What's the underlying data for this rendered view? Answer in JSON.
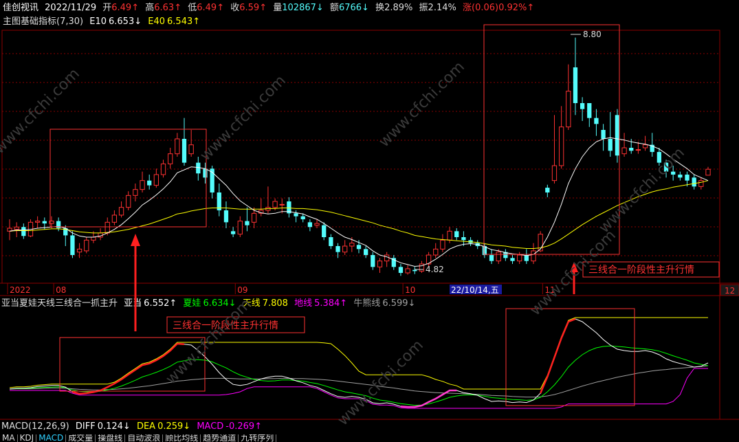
{
  "header": {
    "app": "佳创视讯",
    "date": "2022/11/29",
    "open_label": "开",
    "open": "6.49↑",
    "high_label": "高",
    "high": "6.63↑",
    "low_label": "低",
    "low": "6.49↑",
    "close_label": "收",
    "close": "6.59↑",
    "volume_label": "量",
    "volume": "102867↓",
    "amount_label": "额",
    "amount": "6766↓",
    "turnover_label": "换",
    "turnover": "2.89%",
    "amplitude_label": "振",
    "amplitude": "2.14%",
    "change_label": "涨",
    "change": "(0.06)0.92%↑"
  },
  "indicator_line": {
    "name": "主图基础指标(7,30)",
    "e10_label": "E10",
    "e10": "6.653↓",
    "e40_label": "E40",
    "e40": "6.543↑"
  },
  "mid_indicator": {
    "name": "亚当夏娃天线三线合一抓主升",
    "yadang_label": "亚当",
    "yadang": "6.552↑",
    "xiawa_label": "夏娃",
    "xiawa": "6.634↓",
    "tianxian_label": "天线",
    "tianxian": "7.808",
    "dixian_label": "地线",
    "dixian": "5.384↑",
    "niuxiong_label": "牛熊线",
    "niuxiong": "6.599↓"
  },
  "macd": {
    "name": "MACD(12,26,9)",
    "diff_label": "DIFF",
    "diff": "0.124↓",
    "dea_label": "DEA",
    "dea": "0.259↓",
    "macd_label": "MACD",
    "macd": "-0.269↑"
  },
  "annotations": {
    "box_label": "三线合一阶段性主升行情",
    "max_price": "8.80",
    "min_price": "4.82",
    "cursor_date": "22/10/14,五",
    "right_badge": "12",
    "watermark": "www.cfchi.com"
  },
  "tabs": [
    "MA",
    "KDJ",
    "MACD",
    "成交量",
    "操盘线",
    "自动波浪",
    "顾比均线",
    "趋势通道",
    "九转序列"
  ],
  "active_tab": "MACD",
  "colors": {
    "up": "#ff3232",
    "down": "#54fcfc",
    "e10": "#ffffff",
    "e40": "#ffff00",
    "yadang": "#ffffff",
    "xiawa": "#00ff00",
    "tianxian": "#ffff00",
    "dixian": "#ff00ff",
    "niuxiong": "#a0a0a0",
    "box": "#ff3232",
    "macd_line": "#ff00ff"
  },
  "chart_data": {
    "type": "candlestick",
    "x_axis_labels": [
      "2022",
      "08",
      "09",
      "10",
      "11",
      "12"
    ],
    "price_range": [
      4.7,
      8.9
    ],
    "candles": [
      [
        5.55,
        5.6,
        5.75,
        5.4
      ],
      [
        5.58,
        5.62,
        5.7,
        5.45
      ],
      [
        5.62,
        5.47,
        5.68,
        5.42
      ],
      [
        5.47,
        5.7,
        5.75,
        5.45
      ],
      [
        5.7,
        5.72,
        5.8,
        5.6
      ],
      [
        5.72,
        5.68,
        5.78,
        5.58
      ],
      [
        5.68,
        5.72,
        5.8,
        5.6
      ],
      [
        5.72,
        5.6,
        5.78,
        5.55
      ],
      [
        5.6,
        5.48,
        5.65,
        5.3
      ],
      [
        5.48,
        5.15,
        5.55,
        5.1
      ],
      [
        5.2,
        5.25,
        5.35,
        5.1
      ],
      [
        5.22,
        5.4,
        5.45,
        5.18
      ],
      [
        5.4,
        5.45,
        5.55,
        5.35
      ],
      [
        5.45,
        5.52,
        5.6,
        5.4
      ],
      [
        5.52,
        5.7,
        5.78,
        5.48
      ],
      [
        5.7,
        5.82,
        5.9,
        5.65
      ],
      [
        5.82,
        5.95,
        6.05,
        5.78
      ],
      [
        5.95,
        6.15,
        6.22,
        5.9
      ],
      [
        6.15,
        6.25,
        6.35,
        6.05
      ],
      [
        6.25,
        6.4,
        6.55,
        6.2
      ],
      [
        6.4,
        6.32,
        6.5,
        6.25
      ],
      [
        6.32,
        6.5,
        6.6,
        6.28
      ],
      [
        6.5,
        6.68,
        6.75,
        6.45
      ],
      [
        6.68,
        6.85,
        6.95,
        6.6
      ],
      [
        6.85,
        7.1,
        7.2,
        6.8
      ],
      [
        7.1,
        6.7,
        7.45,
        6.65
      ],
      [
        6.85,
        7.0,
        7.25,
        6.8
      ],
      [
        6.7,
        6.52,
        6.8,
        6.4
      ],
      [
        6.6,
        6.45,
        6.7,
        6.35
      ],
      [
        6.6,
        6.2,
        6.65,
        6.1
      ],
      [
        6.2,
        5.9,
        6.35,
        5.8
      ],
      [
        5.9,
        5.7,
        6.05,
        5.6
      ],
      [
        5.55,
        5.5,
        5.62,
        5.45
      ],
      [
        5.5,
        5.72,
        5.8,
        5.45
      ],
      [
        5.72,
        5.65,
        5.95,
        5.55
      ],
      [
        5.7,
        5.85,
        5.95,
        5.6
      ],
      [
        5.85,
        5.9,
        6.1,
        5.8
      ],
      [
        5.9,
        5.95,
        6.3,
        5.85
      ],
      [
        5.95,
        6.05,
        6.1,
        5.9
      ],
      [
        6.0,
        6.0,
        6.1,
        5.85
      ],
      [
        6.05,
        5.85,
        6.12,
        5.78
      ],
      [
        5.85,
        5.8,
        5.9,
        5.7
      ],
      [
        5.8,
        5.75,
        5.85,
        5.7
      ],
      [
        5.7,
        5.62,
        5.75,
        5.55
      ],
      [
        5.65,
        5.68,
        5.75,
        5.6
      ],
      [
        5.65,
        5.45,
        5.7,
        5.4
      ],
      [
        5.45,
        5.3,
        5.5,
        5.25
      ],
      [
        5.3,
        5.2,
        5.35,
        5.1
      ],
      [
        5.2,
        5.3,
        5.4,
        5.15
      ],
      [
        5.3,
        5.35,
        5.45,
        5.2
      ],
      [
        5.32,
        5.25,
        5.4,
        5.18
      ],
      [
        5.25,
        5.15,
        5.3,
        5.1
      ],
      [
        5.15,
        4.95,
        5.2,
        4.9
      ],
      [
        4.95,
        5.05,
        5.1,
        4.85
      ],
      [
        5.05,
        5.15,
        5.2,
        4.95
      ],
      [
        5.1,
        4.95,
        5.15,
        4.9
      ],
      [
        4.95,
        4.85,
        5.0,
        4.8
      ],
      [
        4.85,
        4.92,
        4.98,
        4.82
      ],
      [
        4.9,
        4.88,
        4.95,
        4.83
      ],
      [
        4.88,
        5.0,
        5.05,
        4.85
      ],
      [
        5.0,
        5.15,
        5.2,
        4.95
      ],
      [
        5.15,
        5.25,
        5.35,
        5.1
      ],
      [
        5.25,
        5.4,
        5.5,
        5.2
      ],
      [
        5.4,
        5.55,
        5.62,
        5.35
      ],
      [
        5.55,
        5.45,
        5.6,
        5.4
      ],
      [
        5.45,
        5.4,
        5.55,
        5.3
      ],
      [
        5.4,
        5.35,
        5.45,
        5.3
      ],
      [
        5.35,
        5.3,
        5.4,
        5.25
      ],
      [
        5.3,
        5.15,
        5.35,
        5.1
      ],
      [
        5.15,
        5.05,
        5.25,
        5.0
      ],
      [
        5.05,
        5.2,
        5.25,
        5.0
      ],
      [
        5.2,
        5.1,
        5.25,
        5.05
      ],
      [
        5.1,
        5.05,
        5.15,
        5.0
      ],
      [
        5.05,
        5.15,
        5.2,
        5.0
      ],
      [
        5.15,
        5.05,
        5.25,
        5.0
      ],
      [
        5.05,
        5.22,
        5.35,
        5.0
      ],
      [
        5.22,
        5.5,
        5.55,
        5.2
      ],
      [
        6.28,
        6.2,
        6.33,
        6.12
      ],
      [
        6.4,
        6.65,
        7.5,
        6.35
      ],
      [
        6.65,
        7.3,
        7.65,
        6.6
      ],
      [
        7.3,
        7.9,
        8.35,
        7.25
      ],
      [
        8.3,
        7.7,
        8.8,
        7.5
      ],
      [
        7.7,
        7.6,
        7.8,
        7.4
      ],
      [
        7.7,
        7.45,
        7.65,
        7.3
      ],
      [
        7.45,
        7.35,
        7.6,
        7.15
      ],
      [
        7.25,
        7.1,
        7.35,
        6.9
      ],
      [
        7.1,
        6.9,
        7.55,
        6.8
      ],
      [
        7.5,
        6.82,
        7.6,
        6.7
      ],
      [
        6.85,
        6.95,
        7.2,
        6.8
      ],
      [
        6.95,
        6.9,
        7.1,
        6.85
      ],
      [
        6.92,
        6.92,
        7.05,
        6.85
      ],
      [
        6.95,
        7.0,
        7.15,
        6.9
      ],
      [
        7.0,
        6.88,
        7.2,
        6.8
      ],
      [
        6.88,
        6.7,
        6.95,
        6.65
      ],
      [
        6.7,
        6.55,
        6.75,
        6.45
      ],
      [
        6.55,
        6.5,
        6.65,
        6.4
      ],
      [
        6.5,
        6.45,
        6.55,
        6.4
      ],
      [
        6.5,
        6.4,
        6.55,
        6.3
      ],
      [
        6.45,
        6.3,
        6.5,
        6.25
      ],
      [
        6.3,
        6.4,
        6.45,
        6.25
      ],
      [
        6.49,
        6.59,
        6.63,
        6.49
      ]
    ],
    "e10": [
      5.55,
      5.57,
      5.57,
      5.58,
      5.6,
      5.61,
      5.62,
      5.63,
      5.6,
      5.52,
      5.47,
      5.45,
      5.45,
      5.47,
      5.52,
      5.58,
      5.66,
      5.76,
      5.87,
      5.99,
      6.07,
      6.16,
      6.26,
      6.38,
      6.53,
      6.58,
      6.63,
      6.62,
      6.6,
      6.54,
      6.43,
      6.32,
      6.18,
      6.06,
      5.98,
      5.9,
      5.86,
      5.84,
      5.85,
      5.88,
      5.88,
      5.86,
      5.84,
      5.79,
      5.75,
      5.68,
      5.6,
      5.52,
      5.45,
      5.41,
      5.36,
      5.31,
      5.22,
      5.15,
      5.12,
      5.07,
      5.02,
      4.99,
      4.96,
      4.97,
      5.01,
      5.08,
      5.16,
      5.25,
      5.3,
      5.33,
      5.34,
      5.33,
      5.29,
      5.24,
      5.22,
      5.19,
      5.17,
      5.16,
      5.14,
      5.16,
      5.25,
      5.45,
      5.7,
      6.0,
      6.35,
      6.6,
      6.8,
      6.95,
      7.05,
      7.1,
      7.12,
      7.1,
      7.08,
      7.05,
      7.03,
      7.01,
      6.98,
      6.93,
      6.85,
      6.76,
      6.68,
      6.6,
      6.5,
      6.45,
      6.4
    ],
    "e40": [
      5.55,
      5.56,
      5.56,
      5.56,
      5.57,
      5.58,
      5.59,
      5.59,
      5.58,
      5.56,
      5.54,
      5.53,
      5.52,
      5.52,
      5.53,
      5.54,
      5.56,
      5.58,
      5.61,
      5.64,
      5.67,
      5.71,
      5.75,
      5.79,
      5.84,
      5.86,
      5.89,
      5.91,
      5.93,
      5.94,
      5.94,
      5.94,
      5.93,
      5.92,
      5.92,
      5.92,
      5.92,
      5.93,
      5.93,
      5.94,
      5.94,
      5.93,
      5.93,
      5.92,
      5.91,
      5.89,
      5.87,
      5.84,
      5.81,
      5.78,
      5.75,
      5.72,
      5.69,
      5.65,
      5.62,
      5.59,
      5.55,
      5.52,
      5.48,
      5.46,
      5.44,
      5.42,
      5.41,
      5.4,
      5.39,
      5.38,
      5.37,
      5.36,
      5.34,
      5.32,
      5.31,
      5.3,
      5.28,
      5.27,
      5.26,
      5.26,
      5.27,
      5.3,
      5.35,
      5.42,
      5.5,
      5.58,
      5.66,
      5.73,
      5.8,
      5.86,
      5.92,
      5.98,
      6.03,
      6.08,
      6.13,
      6.17,
      6.21,
      6.24,
      6.26,
      6.29,
      6.31,
      6.33,
      6.35,
      6.37,
      6.4
    ],
    "yadang": [
      5.55,
      5.58,
      5.58,
      5.6,
      5.64,
      5.66,
      5.68,
      5.68,
      5.62,
      5.45,
      5.38,
      5.4,
      5.44,
      5.5,
      5.62,
      5.75,
      5.9,
      6.08,
      6.25,
      6.42,
      6.48,
      6.6,
      6.75,
      6.95,
      7.2,
      7.18,
      7.15,
      6.95,
      6.72,
      6.45,
      6.15,
      5.9,
      5.72,
      5.68,
      5.72,
      5.82,
      5.92,
      5.98,
      6.02,
      6.02,
      5.95,
      5.85,
      5.78,
      5.68,
      5.62,
      5.5,
      5.38,
      5.28,
      5.25,
      5.28,
      5.25,
      5.18,
      5.05,
      5.02,
      5.05,
      5.0,
      4.92,
      4.9,
      4.9,
      4.95,
      5.08,
      5.2,
      5.35,
      5.5,
      5.5,
      5.42,
      5.38,
      5.32,
      5.2,
      5.1,
      5.12,
      5.1,
      5.06,
      5.08,
      5.06,
      5.15,
      5.4,
      6.0,
      6.7,
      7.4,
      8.0,
      8.1,
      8.0,
      7.8,
      7.6,
      7.35,
      7.15,
      7.0,
      6.95,
      6.92,
      6.92,
      6.95,
      6.9,
      6.8,
      6.65,
      6.55,
      6.48,
      6.42,
      6.35,
      6.38,
      6.5
    ]
  }
}
